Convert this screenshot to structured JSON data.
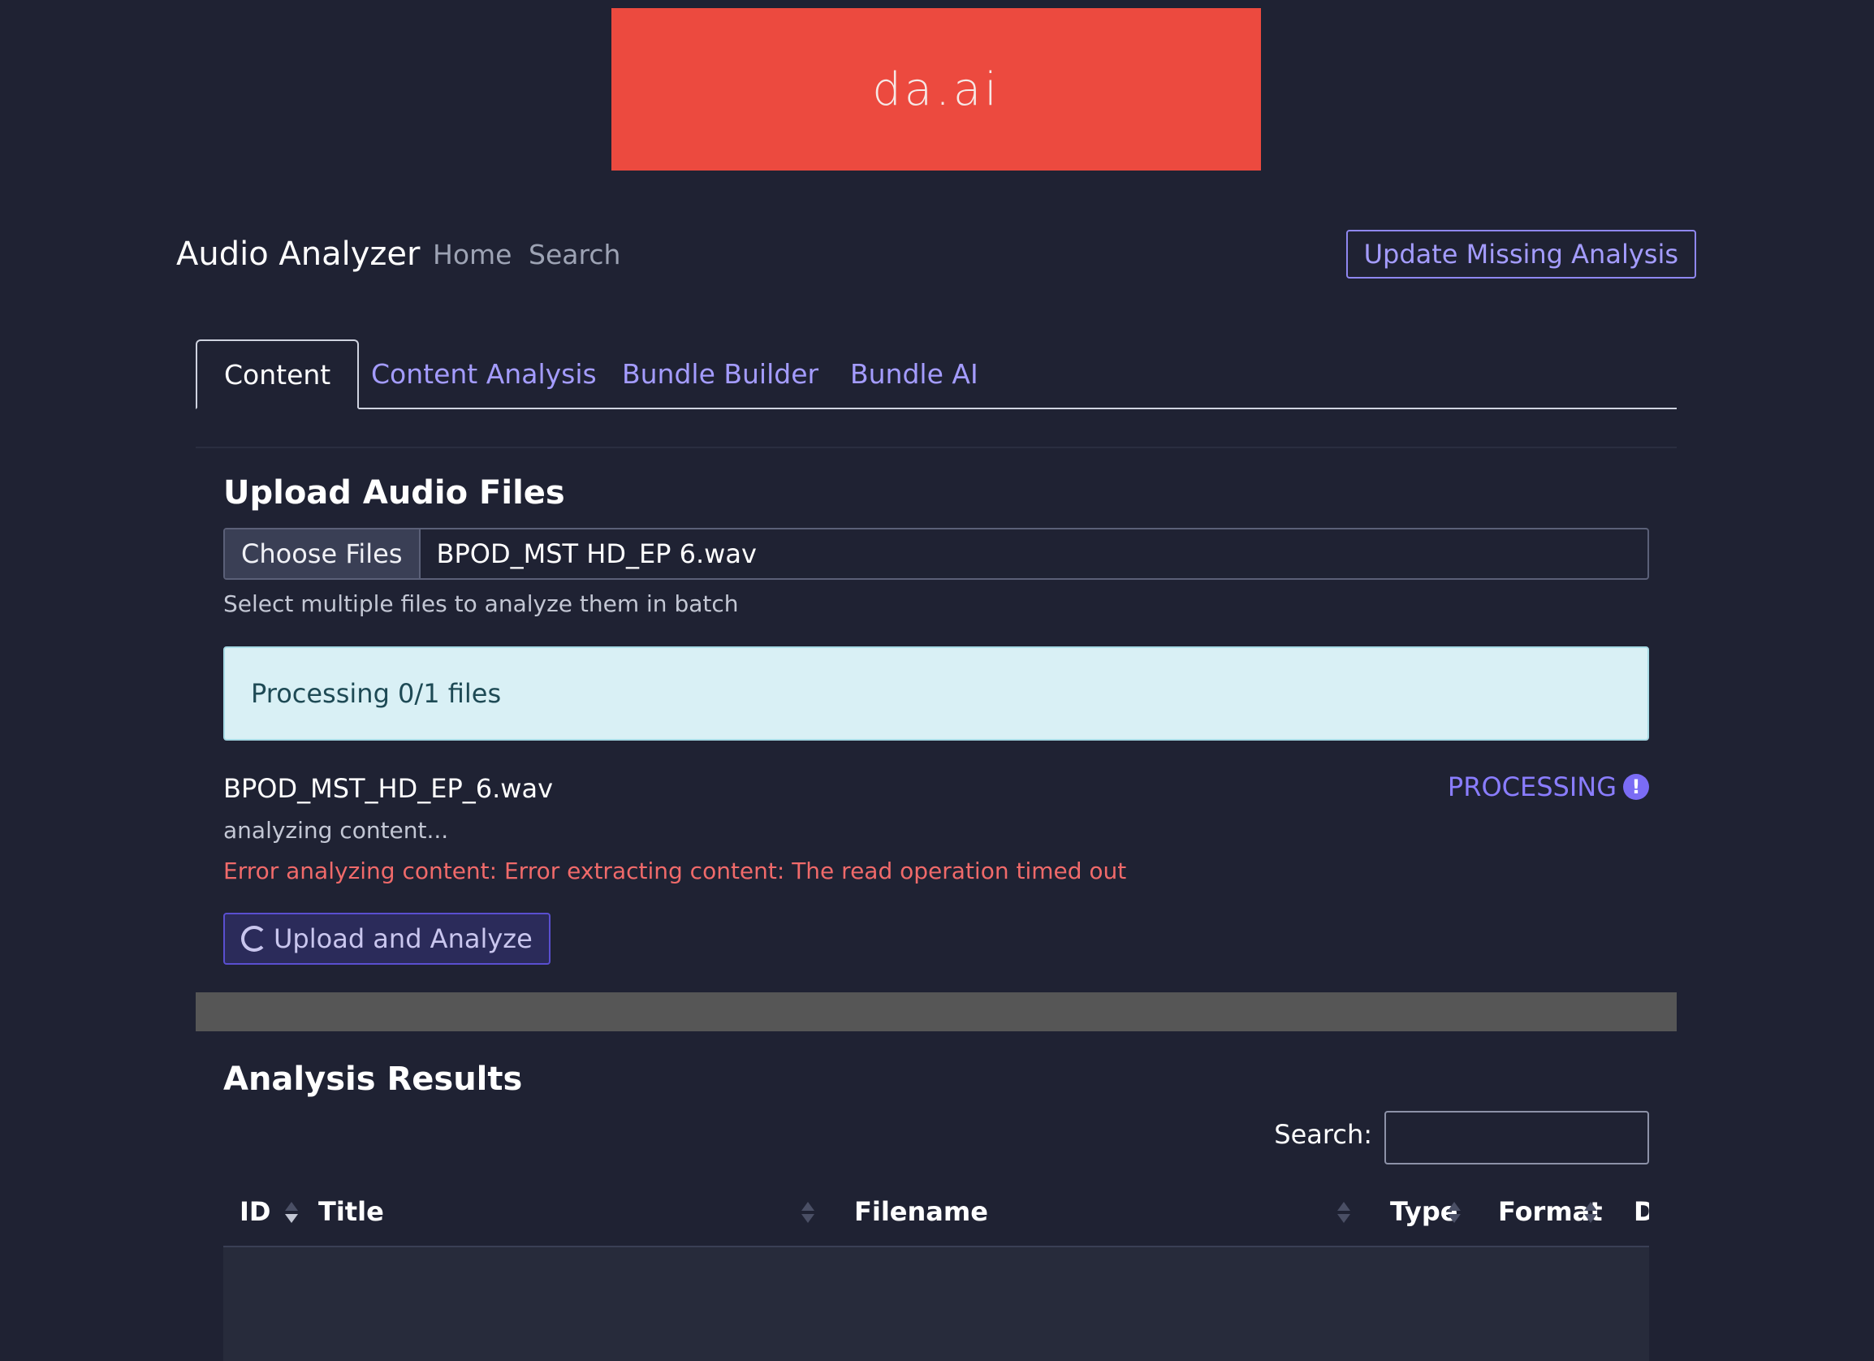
{
  "logo": {
    "text": "da.ai",
    "color": "#ec4a3f"
  },
  "navbar": {
    "brand": "Audio Analyzer",
    "links": [
      "Home",
      "Search"
    ],
    "update_button": "Update Missing Analysis"
  },
  "tabs": [
    {
      "label": "Content",
      "active": true
    },
    {
      "label": "Content Analysis",
      "active": false
    },
    {
      "label": "Bundle Builder",
      "active": false
    },
    {
      "label": "Bundle AI",
      "active": false
    }
  ],
  "upload": {
    "title": "Upload Audio Files",
    "choose_files_label": "Choose Files",
    "selected_file": "BPOD_MST HD_EP 6.wav",
    "help_text": "Select multiple files to analyze them in batch",
    "processing_message": "Processing 0/1 files",
    "file_item": {
      "name": "BPOD_MST_HD_EP_6.wav",
      "status": "PROCESSING",
      "status_icon": "exclamation-icon",
      "progress": "analyzing content...",
      "error": "Error analyzing content: Error extracting content: The read operation timed out"
    },
    "upload_button": "Upload and Analyze"
  },
  "results": {
    "title": "Analysis Results",
    "search_label": "Search:",
    "search_value": "",
    "columns": [
      "ID",
      "Title",
      "Filename",
      "Type",
      "Format",
      "D"
    ],
    "rows": []
  },
  "colors": {
    "background": "#1f2233",
    "accent": "#a49cff",
    "error": "#f06a6a",
    "info_bg": "#d9f0f5"
  }
}
